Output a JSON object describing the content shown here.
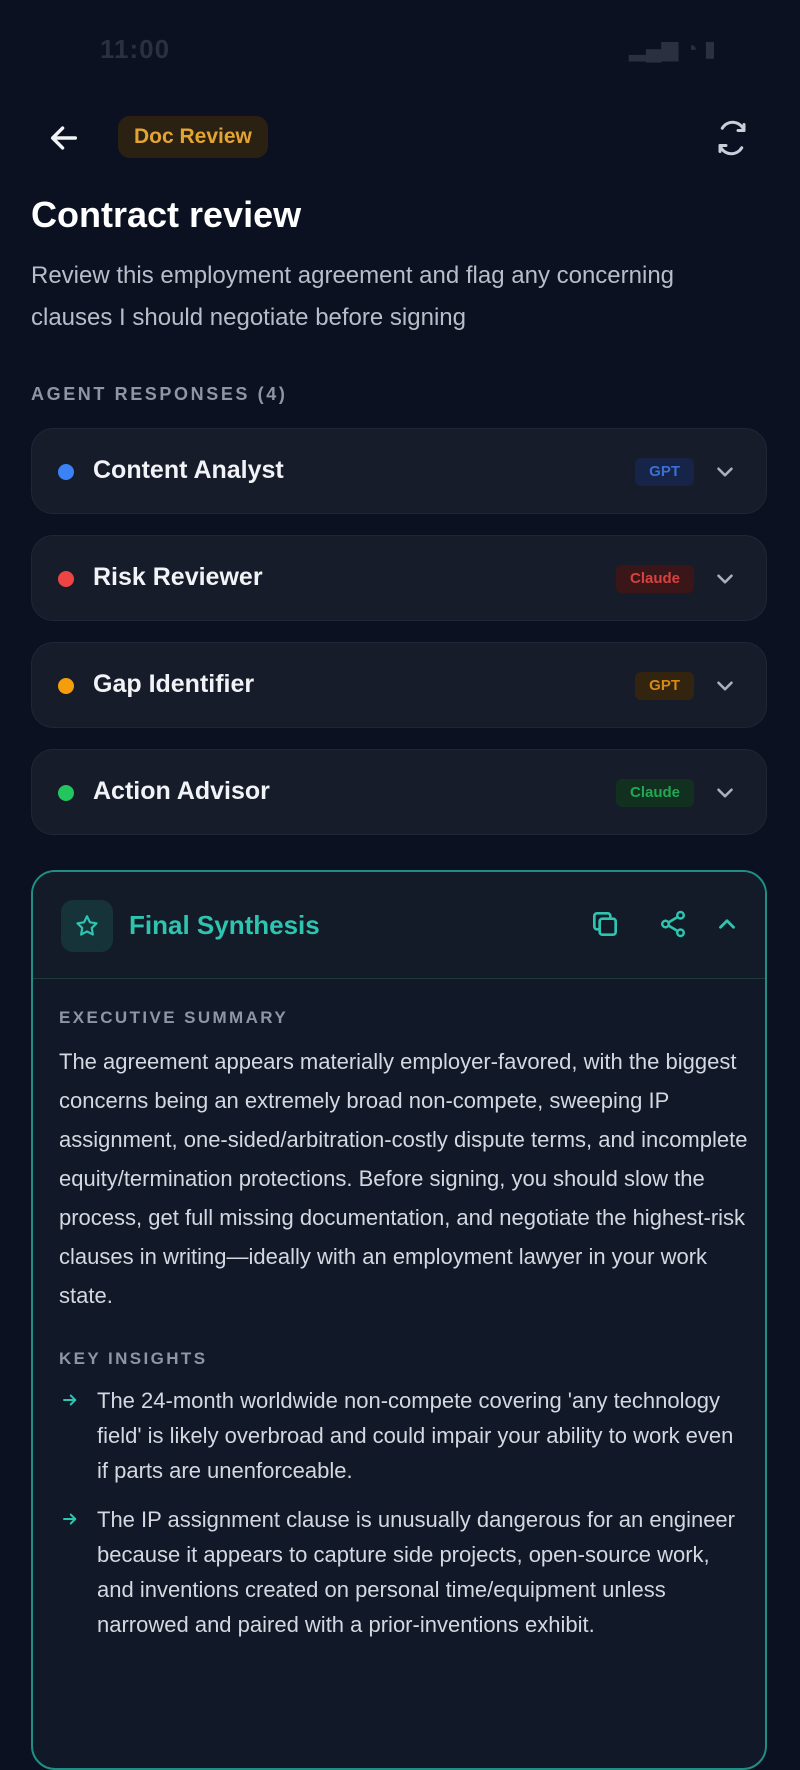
{
  "status": {
    "time": "11:00",
    "icons": "▂▄▆ ◔ ▮"
  },
  "header": {
    "tag": "Doc Review",
    "title": "Contract review",
    "prompt": "Review this employment agreement and flag any concerning clauses I should negotiate before signing"
  },
  "agents": {
    "label": "AGENT RESPONSES (4)",
    "items": [
      {
        "name": "Content Analyst",
        "model": "GPT",
        "dot": "#3b82f6",
        "badge_bg": "#162447",
        "badge_fg": "#3b6fd6"
      },
      {
        "name": "Risk Reviewer",
        "model": "Claude",
        "dot": "#ef4444",
        "badge_bg": "#3a1618",
        "badge_fg": "#d64141"
      },
      {
        "name": "Gap Identifier",
        "model": "GPT",
        "dot": "#f59e0b",
        "badge_bg": "#33240f",
        "badge_fg": "#d68a12"
      },
      {
        "name": "Action Advisor",
        "model": "Claude",
        "dot": "#22c55e",
        "badge_bg": "#12301f",
        "badge_fg": "#21a854"
      }
    ]
  },
  "synthesis": {
    "title": "Final Synthesis",
    "summary_label": "EXECUTIVE SUMMARY",
    "summary": "The agreement appears materially employer-favored, with the biggest concerns being an extremely broad non-compete, sweeping IP assignment, one-sided/arbitration-costly dispute terms, and incomplete equity/termination protections. Before signing, you should slow the process, get full missing documentation, and negotiate the highest-risk clauses in writing—ideally with an employment lawyer in your work state.",
    "insights_label": "KEY INSIGHTS",
    "insights": [
      "The 24-month worldwide non-compete covering 'any technology field' is likely overbroad and could impair your ability to work even if parts are unenforceable.",
      "The IP assignment clause is unusually dangerous for an engineer because it appears to capture side projects, open-source work, and inventions created on personal time/equipment unless narrowed and paired with a prior-inventions exhibit."
    ]
  },
  "colors": {
    "accent": "#2ec4b0",
    "background": "#0b1120"
  }
}
